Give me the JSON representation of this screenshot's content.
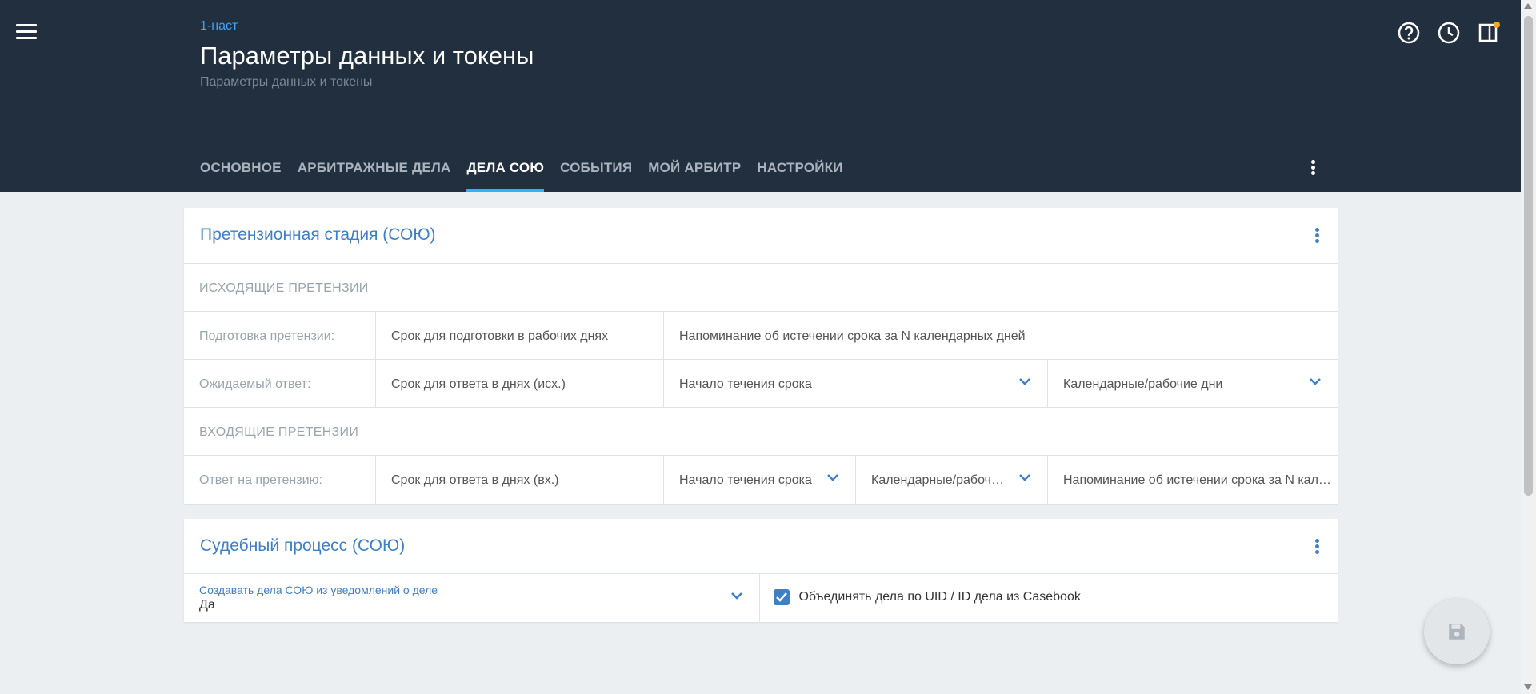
{
  "header": {
    "breadcrumb": "1-наст",
    "title": "Параметры данных и токены",
    "subtitle": "Параметры данных и токены",
    "icons": [
      "menu-icon",
      "help-icon",
      "history-icon",
      "panel-icon"
    ],
    "notification_color": "#f5a623"
  },
  "tabs": [
    {
      "label": "ОСНОВНОЕ",
      "active": false
    },
    {
      "label": "АРБИТРАЖНЫЕ ДЕЛА",
      "active": false
    },
    {
      "label": "ДЕЛА СОЮ",
      "active": true
    },
    {
      "label": "СОБЫТИЯ",
      "active": false
    },
    {
      "label": "МОЙ АРБИТР",
      "active": false
    },
    {
      "label": "НАСТРОЙКИ",
      "active": false
    }
  ],
  "claims": {
    "title": "Претензионная стадия (СОЮ)",
    "outgoing_label": "ИСХОДЯЩИЕ ПРЕТЕНЗИИ",
    "prep_label": "Подготовка претензии:",
    "prep_days_placeholder": "Срок для подготовки в рабочих днях",
    "prep_reminder_placeholder": "Напоминание об истечении срока за N календарных дней",
    "expected_label": "Ожидаемый ответ:",
    "expected_days_placeholder": "Срок для ответа в днях (исх.)",
    "expected_start_placeholder": "Начало течения срока",
    "expected_daytype_placeholder": "Календарные/рабочие дни",
    "incoming_label": "ВХОДЯЩИЕ ПРЕТЕНЗИИ",
    "answer_label": "Ответ на претензию:",
    "answer_days_placeholder": "Срок для ответа в днях (вх.)",
    "answer_start_placeholder": "Начало течения срока",
    "answer_daytype_placeholder": "Календарные/рабочие дни",
    "answer_reminder_placeholder": "Напоминание об истечении срока за N календарных дней"
  },
  "court": {
    "title": "Судебный процесс (СОЮ)",
    "create_label": "Создавать дела СОЮ из уведомлений о деле",
    "create_value": "Да",
    "merge_label": "Объединять дела по UID / ID дела из Casebook",
    "merge_checked": true
  },
  "colors": {
    "header_bg": "#212f3e",
    "accent": "#3f7fc6",
    "tab_indicator": "#29b6f6",
    "page_bg": "#eceff1"
  }
}
